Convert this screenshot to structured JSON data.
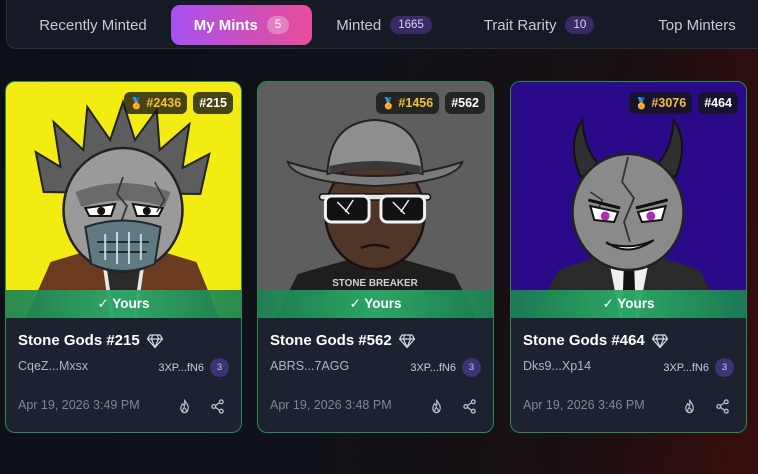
{
  "tabs": [
    {
      "label": "Recently Minted",
      "count": null,
      "active": false
    },
    {
      "label": "My Mints",
      "count": "5",
      "active": true
    },
    {
      "label": "Minted",
      "count": "1665",
      "active": false
    },
    {
      "label": "Trait Rarity",
      "count": "10",
      "active": false
    },
    {
      "label": "Top Minters",
      "count": null,
      "active": false
    }
  ],
  "cards": [
    {
      "rank": "#2436",
      "number": "#215",
      "owned_label": "✓ Yours",
      "title": "Stone Gods #215",
      "owner": "CqeZ...Mxsx",
      "address": "3XP...fN6",
      "address_count": "3",
      "date": "Apr 19, 2026 3:49 PM",
      "bg_color": "#f3ec13",
      "icons": [
        "burn-icon",
        "share-icon"
      ]
    },
    {
      "rank": "#1456",
      "number": "#562",
      "owned_label": "✓ Yours",
      "title": "Stone Gods #562",
      "owner": "ABRS...7AGG",
      "address": "3XP...fN6",
      "address_count": "3",
      "date": "Apr 19, 2026 3:48 PM",
      "bg_color": "#5e5e5e",
      "icons": [
        "burn-icon",
        "share-icon"
      ]
    },
    {
      "rank": "#3076",
      "number": "#464",
      "owned_label": "✓ Yours",
      "title": "Stone Gods #464",
      "owner": "Dks9...Xp14",
      "address": "3XP...fN6",
      "address_count": "3",
      "date": "Apr 19, 2026 3:46 PM",
      "bg_color": "#2b0a8a",
      "icons": [
        "burn-icon",
        "share-icon"
      ]
    }
  ],
  "art_text": {
    "shirt_print": "STONE BREAKER"
  },
  "colors": {
    "accent_gradient_start": "#a652f2",
    "accent_gradient_end": "#e84d9c",
    "owned_green": "#2b8a57",
    "rank_gold": "#f1c232"
  }
}
